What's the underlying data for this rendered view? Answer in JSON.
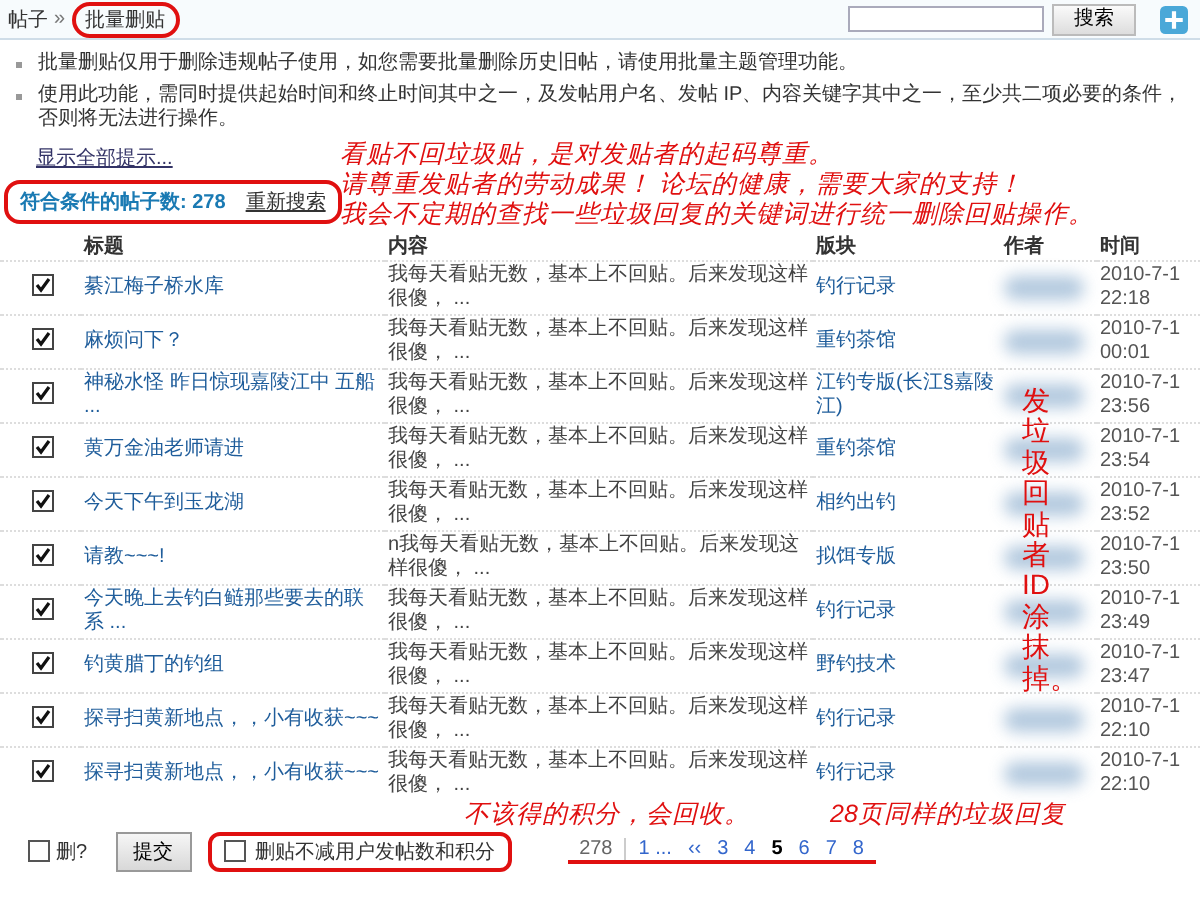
{
  "breadcrumb": {
    "items": [
      {
        "label": "帖子"
      },
      {
        "label": "批量删贴"
      }
    ],
    "separator": "»"
  },
  "search": {
    "button": "搜索"
  },
  "tips": [
    "批量删贴仅用于删除违规帖子使用，如您需要批量删除历史旧帖，请使用批量主题管理功能。",
    "使用此功能，需同时提供起始时间和终止时间其中之一，及发帖用户名、发帖 IP、内容关键字其中之一，至少共二项必要的条件，否则将无法进行操作。"
  ],
  "show_all_link": "显示全部提示...",
  "result": {
    "label": "符合条件的帖子数:",
    "count": "278",
    "research_link": "重新搜索"
  },
  "annotations": [
    "看贴不回垃圾贴，是对发贴者的起码尊重。",
    "请尊重发贴者的劳动成果！  论坛的健康，需要大家的支持！",
    "我会不定期的查找一些垃圾回复的关键词进行统一删除回贴操作。"
  ],
  "vertical_annotation": "发垃圾回贴者ID涂抹掉。",
  "table": {
    "columns": [
      "标题",
      "内容",
      "版块",
      "作者",
      "时间"
    ],
    "rows": [
      {
        "checked": true,
        "title": "綦江梅子桥水库",
        "content": "我每天看贴无数，基本上不回贴。后来发现这样很傻， ...",
        "forum": "钓行记录",
        "date": "2010-7-1",
        "time": "22:18"
      },
      {
        "checked": true,
        "title": "麻烦问下？",
        "content": "我每天看贴无数，基本上不回贴。后来发现这样很傻， ...",
        "forum": "重钓茶馆",
        "date": "2010-7-1",
        "time": "00:01"
      },
      {
        "checked": true,
        "title": "神秘水怪 昨日惊现嘉陵江中 五船 ...",
        "content": "我每天看贴无数，基本上不回贴。后来发现这样很傻， ...",
        "forum": "江钓专版(长江§嘉陵江)",
        "date": "2010-7-1",
        "time": "23:56"
      },
      {
        "checked": true,
        "title": "黄万金油老师请进",
        "content": "我每天看贴无数，基本上不回贴。后来发现这样很傻， ...",
        "forum": "重钓茶馆",
        "date": "2010-7-1",
        "time": "23:54"
      },
      {
        "checked": true,
        "title": "今天下午到玉龙湖",
        "content": "我每天看贴无数，基本上不回贴。后来发现这样很傻， ...",
        "forum": "相约出钓",
        "date": "2010-7-1",
        "time": "23:52"
      },
      {
        "checked": true,
        "title": "请教~~~!",
        "content": "n我每天看贴无数，基本上不回贴。后来发现这样很傻， ...",
        "forum": "拟饵专版",
        "date": "2010-7-1",
        "time": "23:50"
      },
      {
        "checked": true,
        "title": "今天晚上去钓白鲢那些要去的联系 ...",
        "content": "我每天看贴无数，基本上不回贴。后来发现这样很傻， ...",
        "forum": "钓行记录",
        "date": "2010-7-1",
        "time": "23:49"
      },
      {
        "checked": true,
        "title": "钓黄腊丁的钓组",
        "content": "我每天看贴无数，基本上不回贴。后来发现这样很傻， ...",
        "forum": "野钓技术",
        "date": "2010-7-1",
        "time": "23:47"
      },
      {
        "checked": true,
        "title": "探寻扫黄新地点，，小有收获~~~",
        "content": "我每天看贴无数，基本上不回贴。后来发现这样很傻， ...",
        "forum": "钓行记录",
        "date": "2010-7-1",
        "time": "22:10"
      },
      {
        "checked": true,
        "title": "探寻扫黄新地点，，小有收获~~~",
        "content": "我每天看贴无数，基本上不回贴。后来发现这样很傻， ...",
        "forum": "钓行记录",
        "date": "2010-7-1",
        "time": "22:10"
      }
    ]
  },
  "footer": {
    "delete_label": "删?",
    "delete_checked": false,
    "submit": "提交",
    "keep_points_label": "删贴不减用户发帖数和积分",
    "keep_points_checked": false,
    "annotations": [
      "不该得的积分，会回收。",
      "28页同样的垃圾回复"
    ],
    "pagination": [
      {
        "label": "278",
        "kind": "total",
        "selected": false
      },
      {
        "label": "1 ...",
        "kind": "page",
        "selected": false
      },
      {
        "label": "‹‹",
        "kind": "page",
        "selected": false
      },
      {
        "label": "3",
        "kind": "page",
        "selected": false
      },
      {
        "label": "4",
        "kind": "page",
        "selected": false
      },
      {
        "label": "5",
        "kind": "page",
        "selected": true
      },
      {
        "label": "6",
        "kind": "page",
        "selected": false
      },
      {
        "label": "7",
        "kind": "page",
        "selected": false
      },
      {
        "label": "8",
        "kind": "page",
        "selected": false
      }
    ]
  }
}
